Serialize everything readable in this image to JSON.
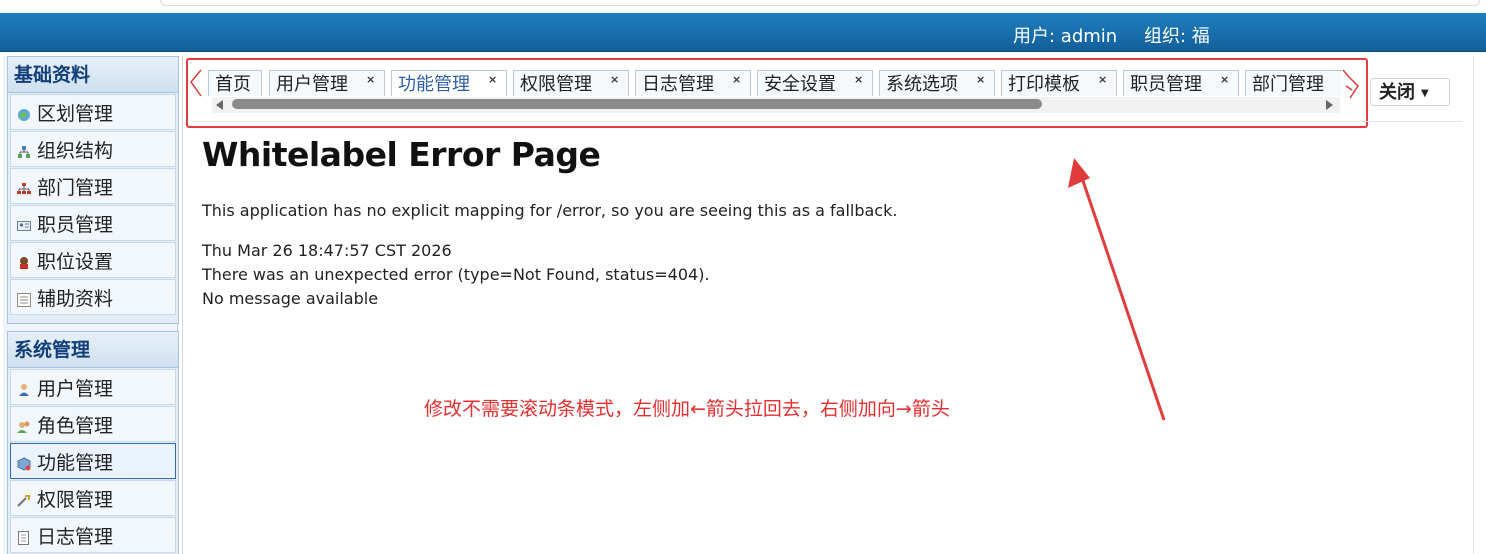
{
  "header": {
    "user": "用户: admin",
    "org": "组织: 福"
  },
  "sidebar": {
    "groups": [
      {
        "title": "基础资料",
        "items": [
          "区划管理",
          "组织结构",
          "部门管理",
          "职员管理",
          "职位设置",
          "辅助资料"
        ]
      },
      {
        "title": "系统管理",
        "items": [
          "用户管理",
          "角色管理",
          "功能管理",
          "权限管理",
          "日志管理"
        ],
        "active": "功能管理"
      }
    ]
  },
  "tabs": [
    {
      "label": "首页",
      "closable": false
    },
    {
      "label": "用户管理",
      "closable": true
    },
    {
      "label": "功能管理",
      "closable": true,
      "active": true
    },
    {
      "label": "权限管理",
      "closable": true
    },
    {
      "label": "日志管理",
      "closable": true
    },
    {
      "label": "安全设置",
      "closable": true
    },
    {
      "label": "系统选项",
      "closable": true
    },
    {
      "label": "打印模板",
      "closable": true
    },
    {
      "label": "职员管理",
      "closable": true
    },
    {
      "label": "部门管理",
      "closable": true
    }
  ],
  "close_menu": {
    "label": "关闭"
  },
  "error": {
    "title": "Whitelabel Error Page",
    "mapping": "This application has no explicit mapping for /error, so you are seeing this as a fallback.",
    "timestamp": "Thu Mar 26 18:47:57 CST 2026",
    "unexpected": "There was an unexpected error (type=Not Found, status=404).",
    "message": "No message available"
  },
  "annotation": "修改不需要滚动条模式，左侧加←箭头拉回去，右侧加向→箭头",
  "colors": {
    "header": "#1a6fae",
    "annotation": "#e03030",
    "active_tab_text": "#2d5fa8",
    "active_item_border": "#2e6db4"
  }
}
